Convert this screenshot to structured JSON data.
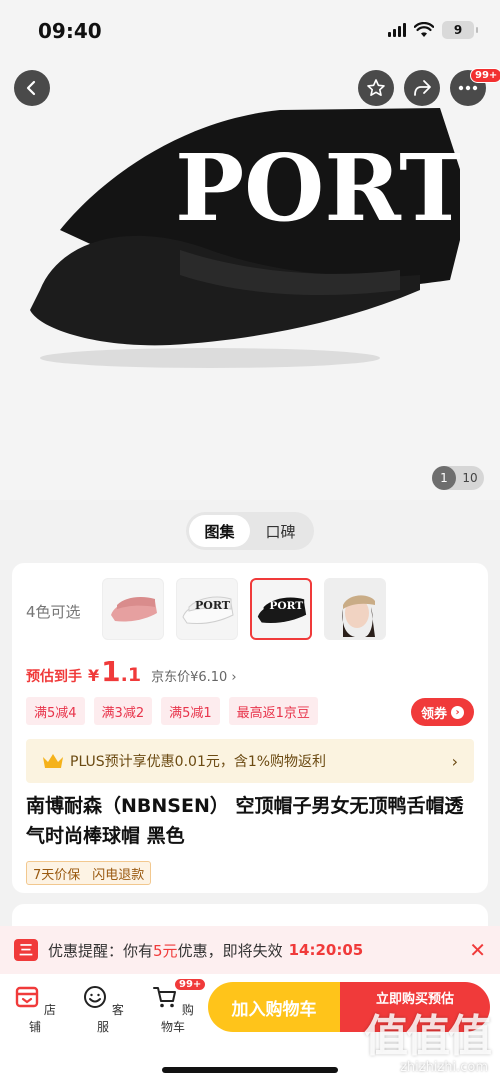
{
  "status_bar": {
    "time": "09:40",
    "battery": "9"
  },
  "hero": {
    "cap_text": "PORT",
    "more_badge": "99+",
    "pager_current": "1",
    "pager_total": "10"
  },
  "tabs": [
    {
      "label": "图集",
      "active": true
    },
    {
      "label": "口碑",
      "active": false
    }
  ],
  "product": {
    "colors_label": "4色可选",
    "thumbnails": [
      {
        "name": "pink",
        "selected": false
      },
      {
        "name": "white",
        "selected": false
      },
      {
        "name": "black",
        "selected": true
      },
      {
        "name": "model",
        "selected": false
      }
    ],
    "price_label": "预估到手",
    "currency": "¥",
    "price_int": "1",
    "price_dec": ".1",
    "jd_price": "京东价¥6.10",
    "promos": [
      "满5减4",
      "满3减2",
      "满5减1",
      "最高返1京豆"
    ],
    "coupon_button": "领券",
    "plus_text": "PLUS预计享优惠0.01元，含1%购物返利",
    "title": "南博耐森（NBNSEN） 空顶帽子男女无顶鸭舌帽透气时尚棒球帽 黑色",
    "service_tags": [
      "7天价保",
      "闪电退款"
    ]
  },
  "notice": {
    "prefix": "优惠提醒：你有",
    "amount": "5元",
    "suffix": "优惠，即将失效",
    "countdown": "14:20:05"
  },
  "bottom_nav": {
    "store": "店铺",
    "service": "客服",
    "cart": "购物车",
    "cart_badge": "99+",
    "add_to_cart": "加入购物车",
    "buy_now": "立即购买预估"
  },
  "watermark": {
    "logo": "值值值",
    "url": "zhizhizhi.com"
  },
  "colors": {
    "accent": "#f03a3a",
    "cart_yellow": "#ffc41a",
    "plus_gold": "#fbf3e0"
  }
}
